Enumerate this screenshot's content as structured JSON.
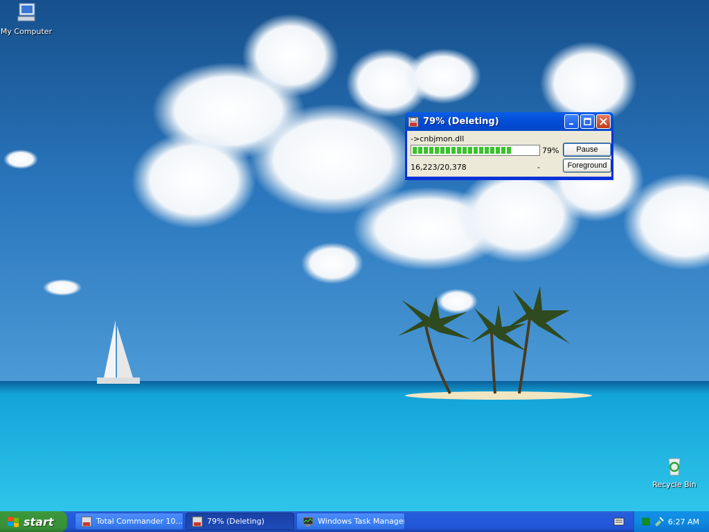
{
  "desktop": {
    "icons": [
      {
        "label": "My Computer",
        "icon": "computer-icon"
      },
      {
        "label": "Recycle Bin",
        "icon": "recycle-bin-icon"
      }
    ]
  },
  "progress_window": {
    "title": "79%  (Deleting)",
    "file_name": "->cnbjmon.dll",
    "progress_percent": 79,
    "percent_label": "79%",
    "count_label": "16,223/20,378",
    "dash": "-",
    "pause_label": "Pause",
    "foreground_label": "Foreground",
    "colors": {
      "title_bar": "#0a5ee8",
      "progress_fill": "#39c42a",
      "client": "#ece9d8"
    }
  },
  "taskbar": {
    "start_label": "start",
    "tasks": [
      {
        "label": "Total Commander 10....",
        "icon": "total-commander-icon",
        "active": false
      },
      {
        "label": "79%  (Deleting)",
        "icon": "disk-icon",
        "active": true
      },
      {
        "label": "Windows Task Manager",
        "icon": "task-manager-icon",
        "active": false
      }
    ],
    "clock": "6:27 AM"
  }
}
